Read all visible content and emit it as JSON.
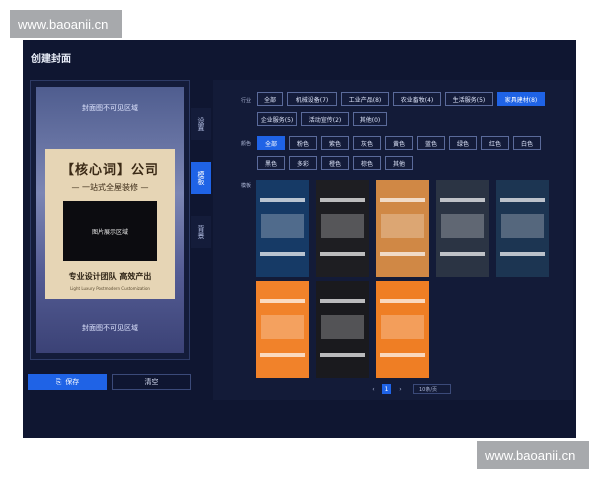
{
  "watermark": "www.baoanii.cn",
  "app": {
    "title": "创建封面"
  },
  "preview": {
    "cover_hint_top": "封面图不可见区域",
    "cover_hint_bottom": "封面图不可见区域",
    "card_title": "【核心词】公司",
    "card_subtitle": "— 一站式全屋装修 —",
    "image_area": "图片展示区域",
    "team_text": "专业设计团队 高效产出",
    "en_text": "Light Luxury Postmodern Customization"
  },
  "side_tabs": [
    {
      "label": "设置",
      "active": false
    },
    {
      "label": "模板",
      "active": true
    },
    {
      "label": "背景",
      "active": false
    }
  ],
  "actions": {
    "save": "保存",
    "clear": "清空"
  },
  "filters": {
    "industry_label": "行业",
    "industry": [
      {
        "label": "全部",
        "active": false
      },
      {
        "label": "机械设备(7)",
        "active": false
      },
      {
        "label": "工业产品(8)",
        "active": false
      },
      {
        "label": "农业畜牧(4)",
        "active": false
      },
      {
        "label": "生活服务(5)",
        "active": false
      },
      {
        "label": "家具建材(8)",
        "active": true
      },
      {
        "label": "企业服务(5)",
        "active": false
      },
      {
        "label": "活动宣传(2)",
        "active": false
      },
      {
        "label": "其他(0)",
        "active": false
      }
    ],
    "color_label": "颜色",
    "colors": [
      {
        "label": "全部",
        "active": true
      },
      {
        "label": "粉色",
        "active": false
      },
      {
        "label": "紫色",
        "active": false
      },
      {
        "label": "灰色",
        "active": false
      },
      {
        "label": "黄色",
        "active": false
      },
      {
        "label": "蓝色",
        "active": false
      },
      {
        "label": "绿色",
        "active": false
      },
      {
        "label": "红色",
        "active": false
      },
      {
        "label": "白色",
        "active": false
      },
      {
        "label": "黑色",
        "active": false
      },
      {
        "label": "多彩",
        "active": false
      },
      {
        "label": "橙色",
        "active": false
      },
      {
        "label": "棕色",
        "active": false
      },
      {
        "label": "其他",
        "active": false
      }
    ],
    "template_label": "模板"
  },
  "templates": [
    {
      "bg": "#163a66"
    },
    {
      "bg": "#1e1e22"
    },
    {
      "bg": "#d08845"
    },
    {
      "bg": "#2b3444"
    },
    {
      "bg": "#1c3552"
    },
    {
      "bg": "#f1822a"
    },
    {
      "bg": "#1a1a1e"
    },
    {
      "bg": "#ef7e24"
    }
  ],
  "pager": {
    "prev": "‹",
    "page": "1",
    "next": "›",
    "per_page": "10条/页"
  }
}
